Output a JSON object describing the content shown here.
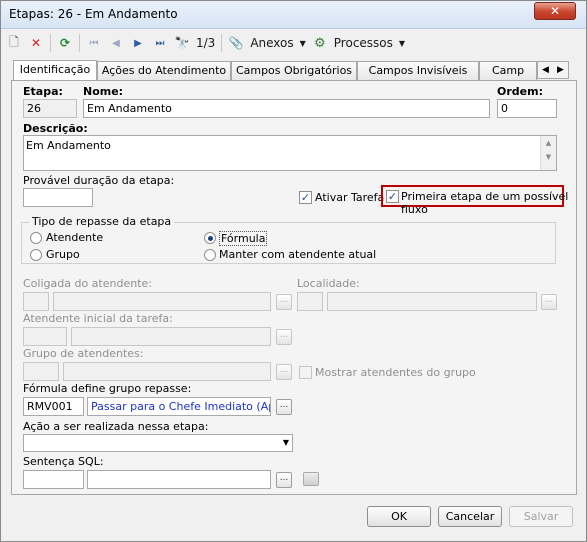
{
  "window": {
    "title": "Etapas: 26 - Em Andamento",
    "close_label": "✕"
  },
  "toolbar": {
    "new_icon": "🗋",
    "delete_icon": "✕",
    "refresh_icon": "⟳",
    "first_icon": "⏮",
    "prev_icon": "◀",
    "next_icon": "▶",
    "last_icon": "⏭",
    "find_icon": "🔭",
    "position": "1/3",
    "anexos_icon": "📎",
    "anexos_label": "Anexos",
    "processos_icon": "⚙",
    "processos_label": "Processos",
    "dropdown_icon": "▼"
  },
  "tabs": [
    "Identificação",
    "Ações do Atendimento",
    "Campos Obrigatórios",
    "Campos Invisíveis",
    "Camp"
  ],
  "tab_nav": {
    "left": "◀",
    "right": "▶"
  },
  "form": {
    "etapa_label": "Etapa:",
    "etapa_value": "26",
    "nome_label": "Nome:",
    "nome_value": "Em Andamento",
    "ordem_label": "Ordem:",
    "ordem_value": "0",
    "descricao_label": "Descrição:",
    "descricao_value": "Em Andamento",
    "duracao_label": "Provável duração da etapa:",
    "duracao_value": "",
    "ativar_tarefa_label": "Ativar Tarefa",
    "primeira_etapa_label": "Primeira etapa de um possível fluxo",
    "tipo_repasse_label": "Tipo de repasse da etapa",
    "radio_atendente": "Atendente",
    "radio_grupo": "Grupo",
    "radio_formula": "Fórmula",
    "radio_manter": "Manter com atendente atual",
    "coligada_label": "Coligada do atendente:",
    "localidade_label": "Localidade:",
    "atendente_inicial_label": "Atendente inicial da tarefa:",
    "grupo_atendentes_label": "Grupo de atendentes:",
    "mostrar_atendentes_label": "Mostrar atendentes do grupo",
    "formula_label": "Fórmula define grupo repasse:",
    "formula_code": "RMV001",
    "formula_desc": "Passar para o Chefe Imediato (Aprovador)",
    "acao_label": "Ação a ser realizada nessa etapa:",
    "acao_value": "",
    "sentenca_label": "Sentença SQL:",
    "browse_label": "..."
  },
  "buttons": {
    "ok": "OK",
    "cancelar": "Cancelar",
    "salvar": "Salvar"
  },
  "colors": {
    "highlight": "#c00000",
    "link_text": "#1a33cc"
  }
}
